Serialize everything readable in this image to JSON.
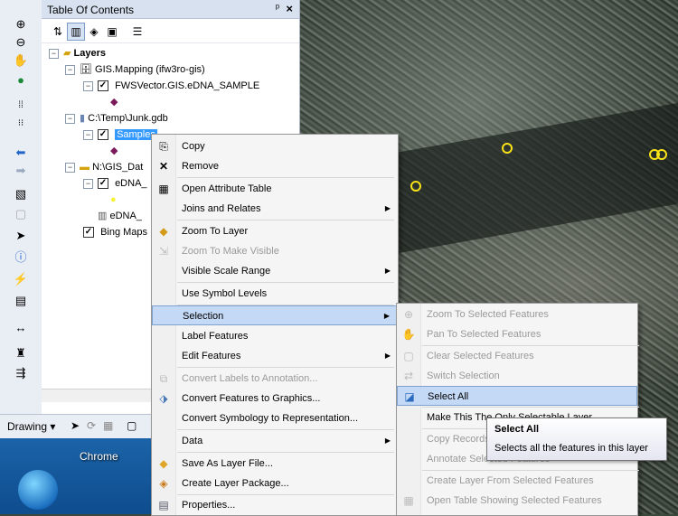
{
  "toc": {
    "title": "Table Of Contents",
    "pin": "ᵖ",
    "close": "×",
    "tree": {
      "layers_label": "Layers",
      "group1": "GIS.Mapping (ifw3ro-gis)",
      "layer1": "FWSVector.GIS.eDNA_SAMPLE",
      "group2": "C:\\Temp\\Junk.gdb",
      "layer2_selected": "Samples",
      "group3": "N:\\GIS_Dat",
      "layer3": "eDNA_",
      "layer4": "eDNA_",
      "layer5": "Bing Maps"
    }
  },
  "drawing": {
    "label": "Drawing ▾"
  },
  "desktop": {
    "chrome_label": "Chrome"
  },
  "context_menu": {
    "items": [
      {
        "label": "Copy",
        "icon": "copy-icon",
        "disabled": false,
        "submenu": false
      },
      {
        "label": "Remove",
        "icon": "remove-icon",
        "disabled": false,
        "submenu": false
      },
      {
        "label": "Open Attribute Table",
        "icon": "table-icon",
        "disabled": false,
        "submenu": false
      },
      {
        "label": "Joins and Relates",
        "icon": "",
        "disabled": false,
        "submenu": true
      },
      {
        "label": "Zoom To Layer",
        "icon": "zoom-layer-icon",
        "disabled": false,
        "submenu": false
      },
      {
        "label": "Zoom To Make Visible",
        "icon": "zoom-visible-icon",
        "disabled": true,
        "submenu": false
      },
      {
        "label": "Visible Scale Range",
        "icon": "",
        "disabled": false,
        "submenu": true
      },
      {
        "label": "Use Symbol Levels",
        "icon": "",
        "disabled": false,
        "submenu": false
      },
      {
        "label": "Selection",
        "icon": "",
        "disabled": false,
        "submenu": true,
        "highlighted": true
      },
      {
        "label": "Label Features",
        "icon": "",
        "disabled": false,
        "submenu": false
      },
      {
        "label": "Edit Features",
        "icon": "",
        "disabled": false,
        "submenu": true
      },
      {
        "label": "Convert Labels to Annotation...",
        "icon": "convert-labels-icon",
        "disabled": true,
        "submenu": false
      },
      {
        "label": "Convert Features to Graphics...",
        "icon": "convert-graphics-icon",
        "disabled": false,
        "submenu": false
      },
      {
        "label": "Convert Symbology to Representation...",
        "icon": "",
        "disabled": false,
        "submenu": false
      },
      {
        "label": "Data",
        "icon": "",
        "disabled": false,
        "submenu": true
      },
      {
        "label": "Save As Layer File...",
        "icon": "layer-file-icon",
        "disabled": false,
        "submenu": false
      },
      {
        "label": "Create Layer Package...",
        "icon": "layer-package-icon",
        "disabled": false,
        "submenu": false
      },
      {
        "label": "Properties...",
        "icon": "properties-icon",
        "disabled": false,
        "submenu": false
      }
    ]
  },
  "selection_menu": {
    "items": [
      {
        "label": "Zoom To Selected Features",
        "disabled": true
      },
      {
        "label": "Pan To Selected Features",
        "disabled": true
      },
      {
        "label": "Clear Selected Features",
        "disabled": true
      },
      {
        "label": "Switch Selection",
        "disabled": true
      },
      {
        "label": "Select All",
        "disabled": false,
        "highlighted": true
      },
      {
        "label": "Make This The Only Selectable Layer",
        "disabled": false
      },
      {
        "label": "Copy Records For Selected Features",
        "disabled": true
      },
      {
        "label": "Annotate Selected Features",
        "disabled": true
      },
      {
        "label": "Create Layer From Selected Features",
        "disabled": true
      },
      {
        "label": "Open Table Showing Selected Features",
        "disabled": true
      }
    ]
  },
  "tooltip": {
    "title": "Select All",
    "description": "Selects all the features in this layer"
  },
  "colors": {
    "selection_highlight": "#3399ff",
    "menu_highlight": "#c4d9f5",
    "point_symbol": "#f7e21a"
  }
}
